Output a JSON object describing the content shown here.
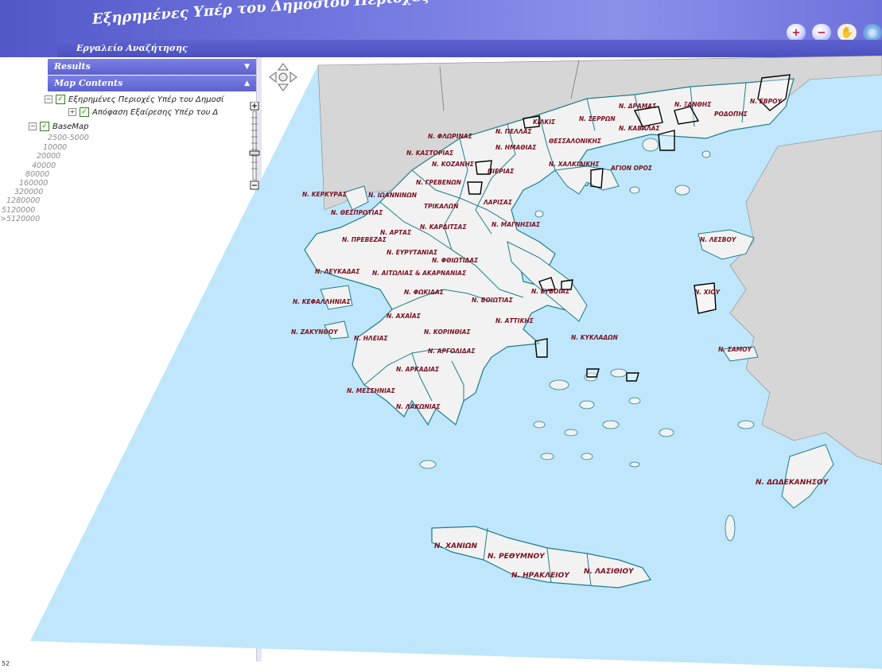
{
  "app": {
    "title": "Εξηρημένες Υπέρ του Δημοσίου Περιοχές",
    "search_tool_label": "Εργαλείο Αναζήτησης"
  },
  "toolbar": {
    "buttons": [
      {
        "name": "zoom-in",
        "glyph": "+"
      },
      {
        "name": "zoom-out",
        "glyph": "−"
      },
      {
        "name": "pan",
        "glyph": "✋"
      },
      {
        "name": "full-extent",
        "glyph": "◎"
      }
    ]
  },
  "panels": {
    "results": {
      "label": "Results",
      "chevron": "▼"
    },
    "map_contents": {
      "label": "Map Contents",
      "chevron": "▲"
    }
  },
  "toc": {
    "layer1": {
      "expander": "−",
      "check": "✓",
      "label": "Εξηρημένες Περιοχές Υπέρ του Δημοσί"
    },
    "layer1_sub": {
      "expander": "+",
      "check": "✓",
      "label": "Απόφαση Εξαίρεσης Υπέρ του Δ"
    },
    "basemap": {
      "expander": "−",
      "check": "✓",
      "label": "BaseMap"
    },
    "scales": [
      "2500-5000",
      "10000",
      "20000",
      "40000",
      "80000",
      "160000",
      "320000",
      "1280000",
      "5120000",
      ">5120000"
    ]
  },
  "map": {
    "colors": {
      "sea": "#bfe6fb",
      "land": "#f2f2f2",
      "foreign_land": "#d6d6d6",
      "boundary": "#1e7d8c",
      "label": "#7a1020"
    },
    "labels": {
      "evros": "Ν. ΕΒΡΟΥ",
      "rodopis": "ΡΟΔΟΠΗΣ",
      "xanthis": "Ν. ΞΑΝΘΗΣ",
      "dramas": "Ν. ΔΡΑΜΑΣ",
      "kavalas": "Ν. ΚΑΒΑΛΑΣ",
      "serron": "Ν. ΣΕΡΡΩΝ",
      "kilkis": "ΚΙΛΚΙΣ",
      "pellas": "Ν. ΠΕΛΛΑΣ",
      "florinas": "Ν. ΦΛΩΡΙΝΑΣ",
      "imathias": "Ν. ΗΜΑΘΙΑΣ",
      "thessalonikis": "ΘΕΣΣΑΛΟΝΙΚΗΣ",
      "kastorias": "Ν. ΚΑΣΤΟΡΙΑΣ",
      "kozanis": "Ν. ΚΟΖΑΝΗΣ",
      "pierias": "ΠΙΕΡΙΑΣ",
      "chalkidikis": "Ν. ΧΑΛΚΙΔΙΚΗΣ",
      "agion_oros": "ΑΓΙΟΝ ΟΡΟΣ",
      "grevenon": "Ν. ΓΡΕΒΕΝΩΝ",
      "kerkyras": "Ν. ΚΕΡΚΥΡΑΣ",
      "ioanninon": "Ν. ΙΩΑΝΝΙΝΩΝ",
      "trikalon": "ΤΡΙΚΑΛΩΝ",
      "larisas": "ΛΑΡΙΣΑΣ",
      "thesprotias": "Ν. ΘΕΣΠΡΩΤΙΑΣ",
      "magnisias": "Ν. ΜΑΓΝΗΣΙΑΣ",
      "artas": "Ν. ΑΡΤΑΣ",
      "karditsas": "Ν. ΚΑΡΔΙΤΣΑΣ",
      "prevezas": "Ν. ΠΡΕΒΕΖΑΣ",
      "evrytanias": "Ν. ΕΥΡΥΤΑΝΙΑΣ",
      "fthiotidas": "Ν. ΦΘΙΩΤΙΔΑΣ",
      "lesvou": "Ν. ΛΕΣΒΟΥ",
      "lefkadas": "Ν. ΛΕΥΚΑΔΑΣ",
      "aitoloakarnanias": "Ν. ΑΙΤΩΛΙΑΣ & ΑΚΑΡΝΑΝΙΑΣ",
      "fokidas": "Ν. ΦΩΚΙΔΑΣ",
      "voiotias": "Ν. ΒΟΙΩΤΙΑΣ",
      "evvoias": "Ν. ΕΥΒΟΙΑΣ",
      "chiou": "Ν. ΧΙΟΥ",
      "kefallinias": "Ν. ΚΕΦΑΛΛΗΝΙΑΣ",
      "achaias": "Ν. ΑΧΑΪΑΣ",
      "attikis": "Ν. ΑΤΤΙΚΗΣ",
      "zakynthou": "Ν. ΖΑΚΥΝΘΟΥ",
      "ileias": "Ν. ΗΛΕΙΑΣ",
      "korinthias": "Ν. ΚΟΡΙΝΘΙΑΣ",
      "kykladon": "Ν. ΚΥΚΛΑΔΩΝ",
      "samou": "Ν. ΣΑΜΟΥ",
      "argolidas": "Ν. ΑΡΓΟΛΙΔΑΣ",
      "arkadias": "Ν. ΑΡΚΑΔΙΑΣ",
      "messinias": "Ν. ΜΕΣΣΗΝΙΑΣ",
      "lakonias": "Ν. ΛΑΚΩΝΙΑΣ",
      "dodekanisou": "Ν. ΔΩΔΕΚΑΝΗΣΟΥ",
      "chanion": "Ν. ΧΑΝΙΩΝ",
      "rethymnou": "Ν. ΡΕΘΥΜΝΟΥ",
      "irakleiou": "Ν. ΗΡΑΚΛΕΙΟΥ",
      "lasithiou": "Ν. ΛΑΣΙΘΙΟΥ"
    }
  },
  "nav": {
    "pan_center": "⊕",
    "zoom_in": "+",
    "zoom_out": "−"
  },
  "footer": {
    "coord_left": "52"
  }
}
